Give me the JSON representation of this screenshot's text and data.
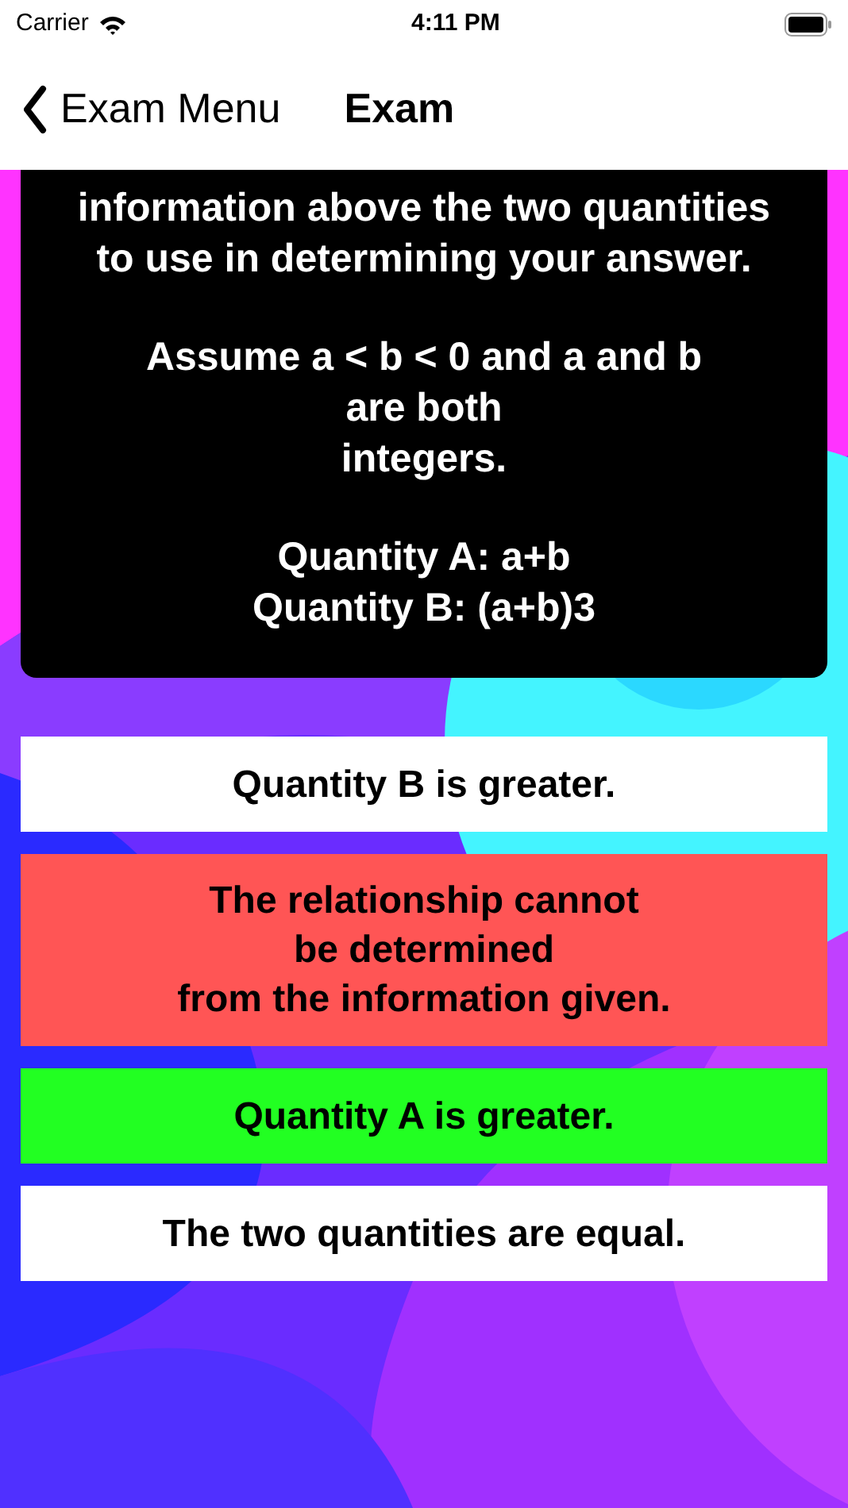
{
  "status_bar": {
    "carrier": "Carrier",
    "time": "4:11 PM"
  },
  "nav": {
    "back_label": "Exam Menu",
    "title": "Exam"
  },
  "question": {
    "paragraphs": [
      "information above the two quantities\nto use in determining your answer.",
      "Assume a < b < 0 and a and b\nare both\nintegers.",
      "Quantity A: a+b\nQuantity B: (a+b)3"
    ]
  },
  "answers": [
    {
      "text": "Quantity B is greater.",
      "color": "#ffffff"
    },
    {
      "text": "The relationship cannot\nbe determined\nfrom the information given.",
      "color": "#ff5555"
    },
    {
      "text": "Quantity A is greater.",
      "color": "#22ff22"
    },
    {
      "text": "The two quantities are equal.",
      "color": "#ffffff"
    }
  ]
}
